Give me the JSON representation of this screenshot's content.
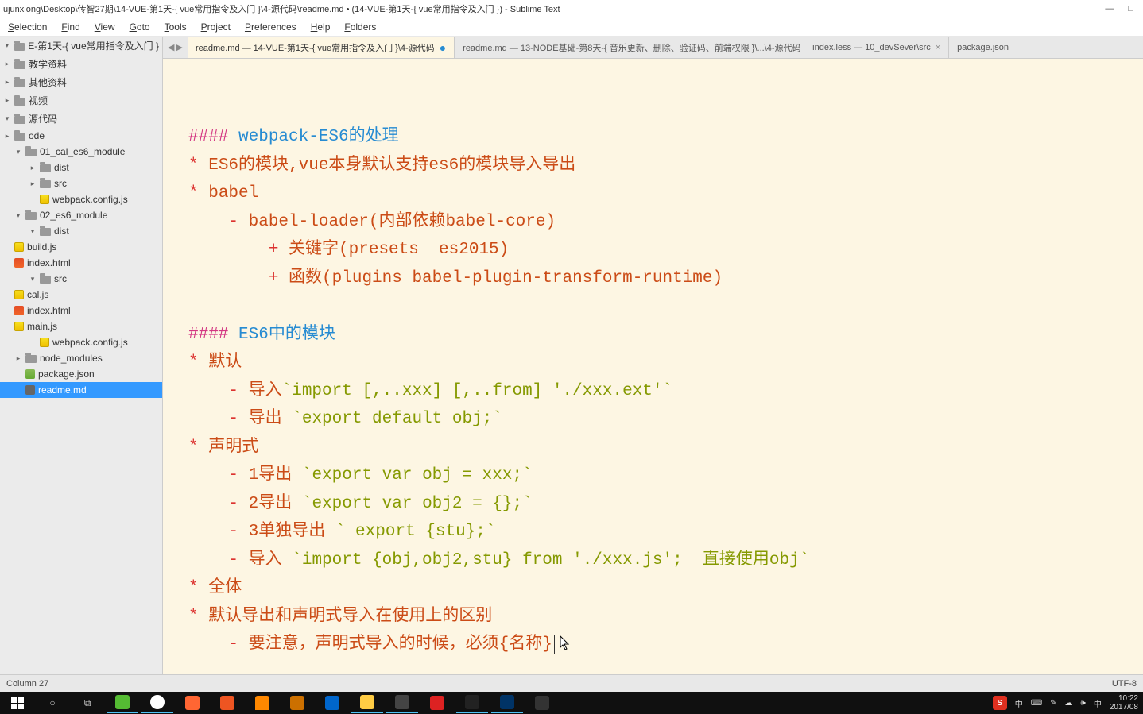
{
  "window": {
    "title": "ujunxiong\\Desktop\\传智27期\\14-VUE-第1天-{ vue常用指令及入门 }\\4-源代码\\readme.md • (14-VUE-第1天-{ vue常用指令及入门 }) - Sublime Text"
  },
  "menu": {
    "items": [
      "Selection",
      "Find",
      "View",
      "Goto",
      "Tools",
      "Project",
      "Preferences",
      "Help",
      "Folders"
    ]
  },
  "sidebar": {
    "items": [
      {
        "label": "E-第1天-{ vue常用指令及入门 }",
        "type": "folder",
        "depth": 0,
        "open": true
      },
      {
        "label": "教学资料",
        "type": "folder",
        "depth": 0
      },
      {
        "label": "其他资料",
        "type": "folder",
        "depth": 0
      },
      {
        "label": "视频",
        "type": "folder",
        "depth": 0
      },
      {
        "label": "源代码",
        "type": "folder",
        "depth": 0,
        "open": true
      },
      {
        "label": "ode",
        "type": "folder",
        "depth": 0
      },
      {
        "label": "01_cal_es6_module",
        "type": "folder",
        "depth": 1,
        "open": true
      },
      {
        "label": "dist",
        "type": "folder",
        "depth": 2
      },
      {
        "label": "src",
        "type": "folder",
        "depth": 2
      },
      {
        "label": "webpack.config.js",
        "type": "js",
        "depth": 2
      },
      {
        "label": "02_es6_module",
        "type": "folder",
        "depth": 1,
        "open": true
      },
      {
        "label": "dist",
        "type": "folder",
        "depth": 2,
        "open": true
      },
      {
        "label": "build.js",
        "type": "js",
        "depth": 3
      },
      {
        "label": "index.html",
        "type": "html",
        "depth": 3
      },
      {
        "label": "src",
        "type": "folder",
        "depth": 2,
        "open": true
      },
      {
        "label": "cal.js",
        "type": "js",
        "depth": 3
      },
      {
        "label": "index.html",
        "type": "html",
        "depth": 3
      },
      {
        "label": "main.js",
        "type": "js",
        "depth": 3
      },
      {
        "label": "webpack.config.js",
        "type": "js",
        "depth": 2
      },
      {
        "label": "node_modules",
        "type": "folder",
        "depth": 1
      },
      {
        "label": "package.json",
        "type": "json",
        "depth": 1
      },
      {
        "label": "readme.md",
        "type": "md",
        "depth": 1,
        "selected": true
      }
    ]
  },
  "tabs": {
    "items": [
      {
        "label": "readme.md — 14-VUE-第1天-{ vue常用指令及入门 }\\4-源代码",
        "active": true,
        "dirty": true
      },
      {
        "label": "readme.md — 13-NODE基础-第8天-{ 音乐更新、删除、验证码、前端权限 }\\...\\4-源代码",
        "active": false,
        "close": true
      },
      {
        "label": "index.less — 10_devSever\\src",
        "active": false,
        "close": true
      },
      {
        "label": "package.json",
        "active": false
      }
    ]
  },
  "editor": {
    "lines": [
      {
        "segments": [
          {
            "t": "#### ",
            "c": "h-pink"
          },
          {
            "t": "webpack-ES6的处理",
            "c": "h-blue"
          }
        ]
      },
      {
        "segments": [
          {
            "t": "* ",
            "c": "h-red"
          },
          {
            "t": "ES6的模块,vue本身默认支持es6的模块导入导出",
            "c": "h-orange"
          }
        ]
      },
      {
        "segments": [
          {
            "t": "* ",
            "c": "h-red"
          },
          {
            "t": "babel",
            "c": "h-orange"
          }
        ]
      },
      {
        "segments": [
          {
            "t": "    - ",
            "c": "h-red"
          },
          {
            "t": "babel-loader(内部依赖babel-core)",
            "c": "h-orange"
          }
        ]
      },
      {
        "segments": [
          {
            "t": "        + ",
            "c": "h-red"
          },
          {
            "t": "关键字(presets  es2015)",
            "c": "h-orange"
          }
        ]
      },
      {
        "segments": [
          {
            "t": "        + ",
            "c": "h-red"
          },
          {
            "t": "函数(plugins babel-plugin-transform-runtime)",
            "c": "h-orange"
          }
        ]
      },
      {
        "segments": [
          {
            "t": " ",
            "c": ""
          }
        ]
      },
      {
        "segments": [
          {
            "t": "#### ",
            "c": "h-pink"
          },
          {
            "t": "ES6中的模块",
            "c": "h-blue"
          }
        ]
      },
      {
        "segments": [
          {
            "t": "* ",
            "c": "h-red"
          },
          {
            "t": "默认",
            "c": "h-orange"
          }
        ]
      },
      {
        "segments": [
          {
            "t": "    - ",
            "c": "h-red"
          },
          {
            "t": "导入",
            "c": "h-orange"
          },
          {
            "t": "`import [,..xxx] [,..from] './xxx.ext'`",
            "c": "h-green"
          }
        ]
      },
      {
        "segments": [
          {
            "t": "    - ",
            "c": "h-red"
          },
          {
            "t": "导出 ",
            "c": "h-orange"
          },
          {
            "t": "`export default obj;`",
            "c": "h-green"
          }
        ]
      },
      {
        "segments": [
          {
            "t": "* ",
            "c": "h-red"
          },
          {
            "t": "声明式",
            "c": "h-orange"
          }
        ]
      },
      {
        "segments": [
          {
            "t": "    - ",
            "c": "h-red"
          },
          {
            "t": "1导出 ",
            "c": "h-orange"
          },
          {
            "t": "`export var obj = xxx;`",
            "c": "h-green"
          }
        ]
      },
      {
        "segments": [
          {
            "t": "    - ",
            "c": "h-red"
          },
          {
            "t": "2导出 ",
            "c": "h-orange"
          },
          {
            "t": "`export var obj2 = {};`",
            "c": "h-green"
          }
        ]
      },
      {
        "segments": [
          {
            "t": "    - ",
            "c": "h-red"
          },
          {
            "t": "3单独导出 ",
            "c": "h-orange"
          },
          {
            "t": "` export {stu};`",
            "c": "h-green"
          }
        ]
      },
      {
        "segments": [
          {
            "t": "    - ",
            "c": "h-red"
          },
          {
            "t": "导入 ",
            "c": "h-orange"
          },
          {
            "t": "`import {obj,obj2,stu} from './xxx.js';  直接使用obj`",
            "c": "h-green"
          }
        ]
      },
      {
        "segments": [
          {
            "t": "* ",
            "c": "h-red"
          },
          {
            "t": "全体",
            "c": "h-orange"
          }
        ]
      },
      {
        "segments": [
          {
            "t": "* ",
            "c": "h-red"
          },
          {
            "t": "默认导出和声明式导入在使用上的区别",
            "c": "h-orange"
          }
        ]
      },
      {
        "segments": [
          {
            "t": "    - ",
            "c": "h-red"
          },
          {
            "t": "要注意，声明式导入的时候，必须{名称}",
            "c": "h-orange"
          }
        ],
        "cursor": true
      }
    ]
  },
  "statusbar": {
    "left": "Column 27",
    "encoding": "UTF-8"
  },
  "taskbar": {
    "tray_items": [
      "中",
      "⌨",
      "☁",
      "🔊",
      "中"
    ],
    "time": "10:22",
    "date": "2017/08"
  }
}
